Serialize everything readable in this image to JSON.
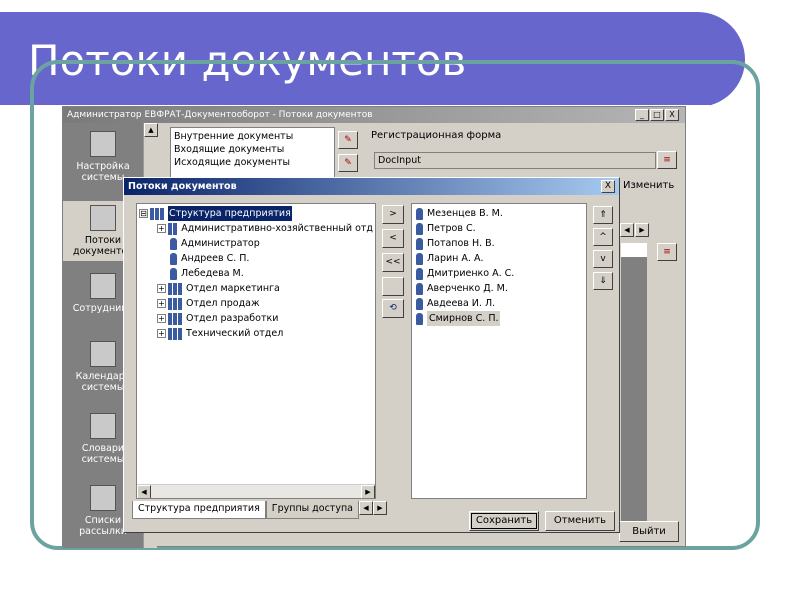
{
  "slide": {
    "title": "Потоки документов"
  },
  "app": {
    "title": "Администратор ЕВФРАТ-Документооборот - Потоки документов",
    "window_buttons": [
      "_",
      "□",
      "X"
    ],
    "sidebar": [
      {
        "label": "Настройка системы"
      },
      {
        "label": "Потоки документов"
      },
      {
        "label": "Сотрудники"
      },
      {
        "label": "Календарь системы"
      },
      {
        "label": "Словари системы"
      },
      {
        "label": "Списки рассылки"
      }
    ],
    "doc_types": [
      "Внутренние документы",
      "Входящие документы",
      "Исходящие документы"
    ],
    "reg_form_label": "Регистрационная форма",
    "reg_form_value": "DocInput",
    "change_label": "Изменить",
    "exit_label": "Выйти"
  },
  "dialog": {
    "title": "Потоки документов",
    "close": "X",
    "tree": [
      {
        "label": "Структура предприятия",
        "level": 0,
        "kind": "group",
        "toggle": "⊟",
        "selected": true
      },
      {
        "label": "Административно-хозяйственный отд",
        "level": 1,
        "kind": "group",
        "toggle": "+"
      },
      {
        "label": "Администратор",
        "level": 1,
        "kind": "person"
      },
      {
        "label": "Андреев С. П.",
        "level": 1,
        "kind": "person"
      },
      {
        "label": "Лебедева М.",
        "level": 1,
        "kind": "person"
      },
      {
        "label": "Отдел маркетинга",
        "level": 1,
        "kind": "group",
        "toggle": "+"
      },
      {
        "label": "Отдел продаж",
        "level": 1,
        "kind": "group",
        "toggle": "+"
      },
      {
        "label": "Отдел разработки",
        "level": 1,
        "kind": "group",
        "toggle": "+"
      },
      {
        "label": "Технический отдел",
        "level": 1,
        "kind": "group",
        "toggle": "+"
      }
    ],
    "mid_buttons": [
      ">",
      "<",
      "<<",
      "",
      "⟲"
    ],
    "members": [
      "Мезенцев В. М.",
      "Петров С.",
      "Потапов Н. В.",
      "Ларин А. А.",
      "Дмитриенко А. С.",
      "Аверченко Д. М.",
      "Авдеева И. Л.",
      "Смирнов С. П."
    ],
    "order_buttons": [
      "⇑",
      "^",
      "v",
      "⇓"
    ],
    "tabs": [
      "Структура предприятия",
      "Группы доступа"
    ],
    "save_label": "Сохранить",
    "cancel_label": "Отменить"
  }
}
